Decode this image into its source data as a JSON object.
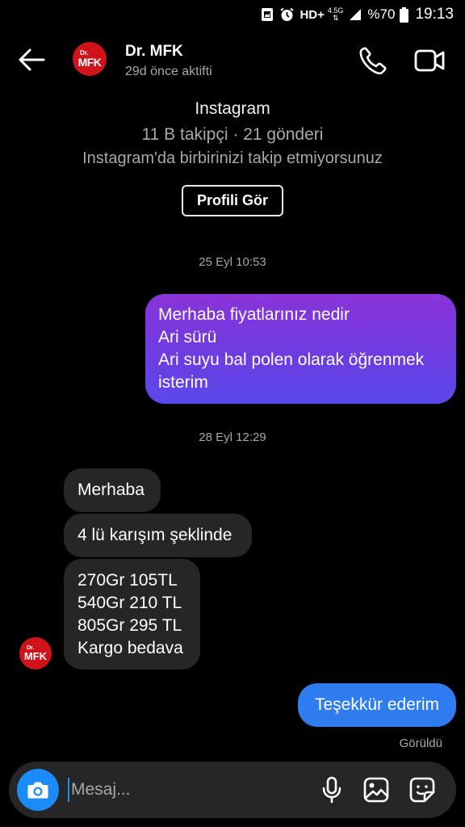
{
  "status_bar": {
    "network": "HD+",
    "network_gen": "4.5G",
    "battery": "%70",
    "time": "19:13"
  },
  "header": {
    "avatar_top": "Dr.",
    "avatar_main": "MFK",
    "name": "Dr. MFK",
    "status": "29d önce aktifti"
  },
  "profile": {
    "platform": "Instagram",
    "stats": "11 B takipçi · 21 gönderi",
    "mutual": "Instagram'da birbirinizi takip etmiyorsunuz",
    "view_profile_label": "Profili Gör"
  },
  "messages": {
    "ts1": "25 Eyl 10:53",
    "outgoing1": [
      "Merhaba fiyatlarınız nedir",
      "Ari sürü",
      "Ari suyu bal polen olarak öğrenmek",
      "isterim"
    ],
    "ts2": "28 Eyl 12:29",
    "incoming1": "Merhaba",
    "incoming2": "4 lü karışım şeklinde",
    "incoming3": [
      "270Gr 105TL",
      "540Gr 210 TL",
      "805Gr 295 TL",
      "Kargo bedava"
    ],
    "outgoing2": "Teşekkür ederim",
    "seen": "Görüldü"
  },
  "composer": {
    "placeholder": "Mesaj..."
  },
  "colors": {
    "background": "#000000",
    "incoming_bubble": "#262626",
    "outgoing_gradient_start": "#8a33d8",
    "outgoing_gradient_end": "#5a49ea",
    "outgoing_blue": "#2f7cf0",
    "accent": "#1a8cf8",
    "avatar": "#d0121b"
  },
  "icons": [
    "back-arrow-icon",
    "phone-icon",
    "video-camera-icon",
    "camera-icon",
    "microphone-icon",
    "gallery-icon",
    "sticker-icon"
  ]
}
